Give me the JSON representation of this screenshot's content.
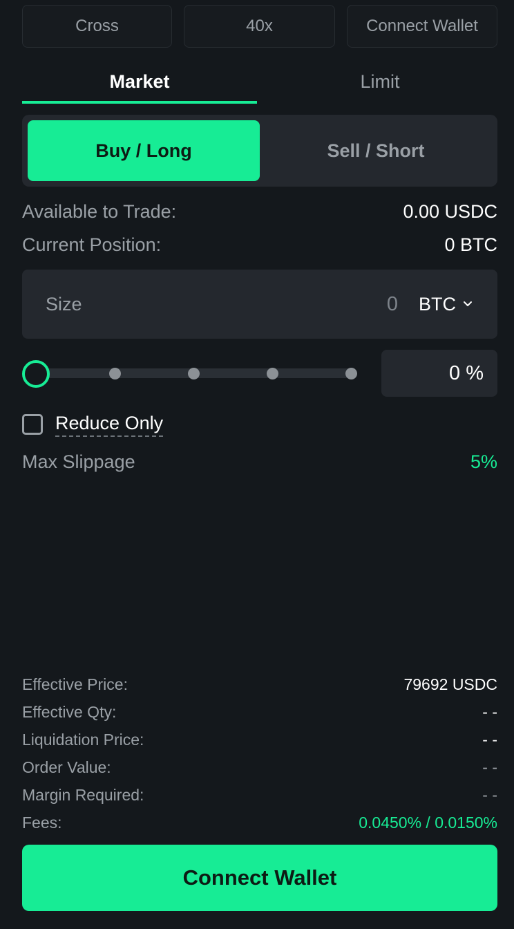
{
  "header": {
    "margin_mode": "Cross",
    "leverage": "40x",
    "connect_wallet": "Connect Wallet"
  },
  "order_type_tabs": [
    {
      "label": "Market",
      "active": true
    },
    {
      "label": "Limit",
      "active": false
    }
  ],
  "side": {
    "buy_label": "Buy / Long",
    "sell_label": "Sell / Short",
    "selected": "buy"
  },
  "account": {
    "available_label": "Available to Trade:",
    "available_value": "0.00 USDC",
    "position_label": "Current Position:",
    "position_value": "0 BTC"
  },
  "size": {
    "label": "Size",
    "placeholder": "0",
    "unit": "BTC"
  },
  "slider": {
    "percent": 0,
    "percent_display": "0 %",
    "stops": [
      0,
      25,
      50,
      75,
      100
    ]
  },
  "reduce_only": {
    "label": "Reduce Only",
    "checked": false
  },
  "slippage": {
    "label": "Max Slippage",
    "value": "5%"
  },
  "summary": [
    {
      "label": "Effective Price:",
      "value": "79692 USDC",
      "style": "normal"
    },
    {
      "label": "Effective Qty:",
      "value": "- -",
      "style": "normal"
    },
    {
      "label": "Liquidation Price:",
      "value": "- -",
      "style": "normal"
    },
    {
      "label": "Order Value:",
      "value": "- -",
      "style": "muted"
    },
    {
      "label": "Margin Required:",
      "value": "- -",
      "style": "muted"
    },
    {
      "label": "Fees:",
      "value": "0.0450% / 0.0150%",
      "style": "accent"
    }
  ],
  "cta": {
    "label": "Connect Wallet"
  },
  "colors": {
    "background": "#14181c",
    "accent": "#17ec95",
    "panel": "#24282e",
    "muted_text": "#9aa0a6"
  }
}
